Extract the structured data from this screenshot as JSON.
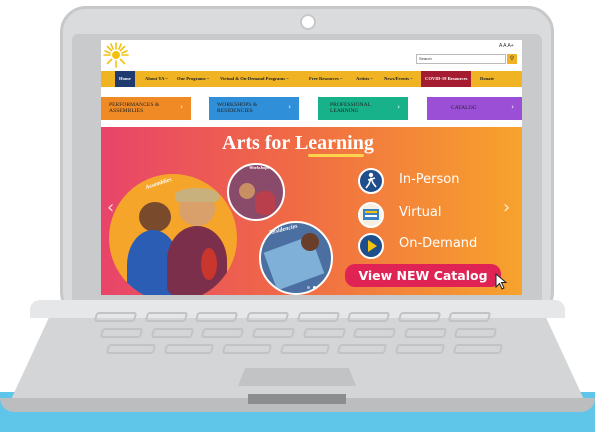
{
  "site": {
    "utility": "A A A+",
    "search": {
      "placeholder": "Search",
      "button_icon": "search-icon"
    },
    "nav": {
      "items": [
        "Home",
        "About YA ~",
        "Our Programs ~",
        "Virtual & On-Demand Programs ~",
        "Free Resources ~",
        "Artists ~",
        "News/Events ~",
        "COVID-19 Resources",
        "Donate"
      ]
    },
    "category_buttons": [
      {
        "label": "PERFORMANCES & ASSEMBLIES",
        "color": "#f08a24"
      },
      {
        "label": "WORKSHOPS & RESIDENCIES",
        "color": "#2f8fd8"
      },
      {
        "label": "PROFESSIONAL LEARNING",
        "color": "#17b28a"
      },
      {
        "label": "CATALOG",
        "color": "#9b4fd6"
      }
    ],
    "hero": {
      "title": "Arts for Learning",
      "badges": [
        "Assemblies",
        "Workshops",
        "Residencies"
      ],
      "options": [
        {
          "label": "In-Person",
          "icon": "dancer-icon"
        },
        {
          "label": "Virtual",
          "icon": "screen-icon"
        },
        {
          "label": "On-Demand",
          "icon": "play-icon"
        }
      ],
      "cta": "View NEW Catalog",
      "prev_icon": "chevron-left-icon",
      "next_icon": "chevron-right-icon"
    }
  },
  "colors": {
    "nav_bg": "#f0b323",
    "nav_active": "#1e3a6e",
    "covid": "#a51c30",
    "cta": "#e02355",
    "hero_start": "#e8446a",
    "hero_end": "#f7a32c"
  }
}
